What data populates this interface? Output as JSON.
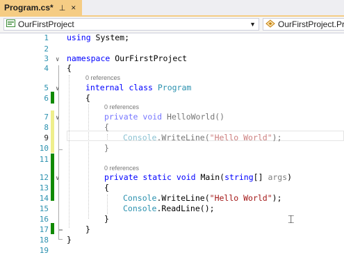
{
  "tab": {
    "title": "Program.cs*",
    "pin_glyph": "⊥",
    "close_glyph": "×"
  },
  "nav": {
    "project_dropdown": "OurFirstProject",
    "class_dropdown": "OurFirstProject.Pro",
    "project_icon": "csharp-project-icon",
    "class_icon": "class-icon"
  },
  "editor": {
    "line_numbers": [
      "1",
      "2",
      "3",
      "4",
      "5",
      "6",
      "7",
      "8",
      "9",
      "10",
      "11",
      "12",
      "13",
      "14",
      "15",
      "16",
      "17",
      "18",
      "19"
    ],
    "current_line": "9",
    "lens": {
      "internal_class": "0 references",
      "hello_world": "0 references",
      "main": "0 references"
    },
    "code": {
      "l1_kw": "using",
      "l1_rest": " System;",
      "l3_kw": "namespace",
      "l3_rest": " OurFirstProject",
      "l4": "{",
      "l5_kw1": "internal",
      "l5_kw2": " class",
      "l5_ty": " Program",
      "l6": "{",
      "l7_kw1": "private",
      "l7_kw2": " void",
      "l7_nm": " HelloWorld()",
      "l8": "{",
      "l9_ty": "Console",
      "l9_a": ".WriteLine(",
      "l9_st": "\"Hello World\"",
      "l9_b": ");",
      "l10": "}",
      "l12_kw1": "private",
      "l12_kw2": " static",
      "l12_kw3": " void",
      "l12_nm": " Main(",
      "l12_kw4": "string",
      "l12_b": "[] ",
      "l12_pm": "args",
      "l12_c": ")",
      "l13": "{",
      "l14_ty": "Console",
      "l14_a": ".WriteLine(",
      "l14_st": "\"Hello World\"",
      "l14_b": ");",
      "l15_ty": "Console",
      "l15_a": ".ReadLine();",
      "l16": "}",
      "l17": "}",
      "l18": "}"
    }
  }
}
